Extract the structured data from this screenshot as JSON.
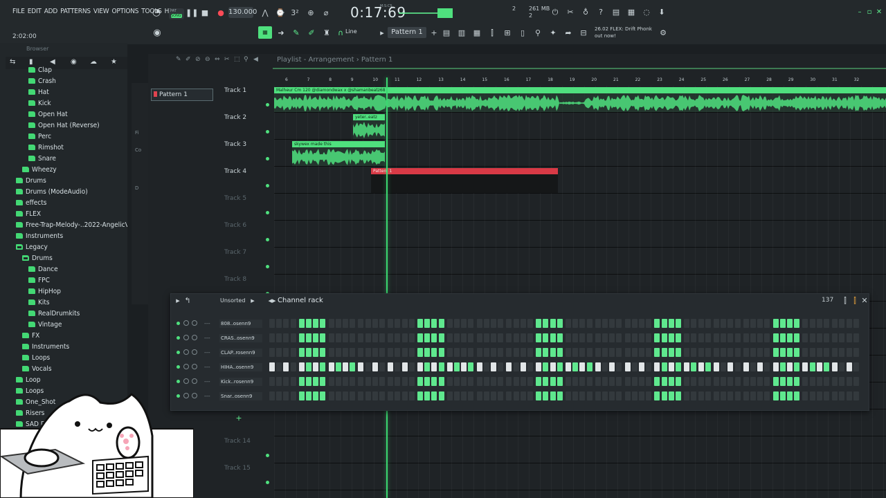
{
  "menu": [
    "FILE",
    "EDIT",
    "ADD",
    "PATTERNS",
    "VIEW",
    "OPTIONS",
    "TOOLS",
    "HELP"
  ],
  "transport": {
    "pat_label": "PAT",
    "song_label": "SONG",
    "bpm": "130.000",
    "time": "0:17:69",
    "time_unit": "M:S:CS",
    "clock": "2:02:00",
    "cpu_label": "2",
    "mem": "261 MB",
    "poly": "2"
  },
  "toolbar": {
    "snap_label": "Line",
    "pattern_select": "Pattern 1",
    "news_line1": "26.02  FLEX: Drift Phonk",
    "news_line2": "out now!"
  },
  "browser": {
    "title": "Browser",
    "items": [
      {
        "label": "Clap",
        "indent": 3,
        "open": false
      },
      {
        "label": "Crash",
        "indent": 3,
        "open": false
      },
      {
        "label": "Hat",
        "indent": 3,
        "open": false
      },
      {
        "label": "Kick",
        "indent": 3,
        "open": false
      },
      {
        "label": "Open Hat",
        "indent": 3,
        "open": false
      },
      {
        "label": "Open Hat (Reverse)",
        "indent": 3,
        "open": false
      },
      {
        "label": "Perc",
        "indent": 3,
        "open": false
      },
      {
        "label": "Rimshot",
        "indent": 3,
        "open": false
      },
      {
        "label": "Snare",
        "indent": 3,
        "open": false
      },
      {
        "label": "Wheezy",
        "indent": 2,
        "open": false
      },
      {
        "label": "Drums",
        "indent": 1,
        "open": false
      },
      {
        "label": "Drums (ModeAudio)",
        "indent": 1,
        "open": false
      },
      {
        "label": "effects",
        "indent": 1,
        "open": false
      },
      {
        "label": "FLEX",
        "indent": 1,
        "open": false
      },
      {
        "label": "Free-Trap-Melody-..2022-AngelicVibes",
        "indent": 1,
        "open": false
      },
      {
        "label": "Instruments",
        "indent": 1,
        "open": false
      },
      {
        "label": "Legacy",
        "indent": 1,
        "open": true
      },
      {
        "label": "Drums",
        "indent": 2,
        "open": true
      },
      {
        "label": "Dance",
        "indent": 3,
        "open": false
      },
      {
        "label": "FPC",
        "indent": 3,
        "open": false
      },
      {
        "label": "HipHop",
        "indent": 3,
        "open": false
      },
      {
        "label": "Kits",
        "indent": 3,
        "open": false
      },
      {
        "label": "RealDrumkits",
        "indent": 3,
        "open": false
      },
      {
        "label": "Vintage",
        "indent": 3,
        "open": false
      },
      {
        "label": "FX",
        "indent": 2,
        "open": false
      },
      {
        "label": "Instruments",
        "indent": 2,
        "open": false
      },
      {
        "label": "Loops",
        "indent": 2,
        "open": false
      },
      {
        "label": "Vocals",
        "indent": 2,
        "open": false
      },
      {
        "label": "Loop",
        "indent": 1,
        "open": false
      },
      {
        "label": "Loops",
        "indent": 1,
        "open": false
      },
      {
        "label": "One_Shot",
        "indent": 1,
        "open": false
      },
      {
        "label": "Risers",
        "indent": 1,
        "open": false
      },
      {
        "label": "SAD DR",
        "indent": 1,
        "open": false
      }
    ]
  },
  "playlist": {
    "title": "Playlist - Arrangement",
    "pattern": "Pattern 1",
    "picker_label": "Pattern 1",
    "ruler": [
      "6",
      "7",
      "8",
      "9",
      "10",
      "11",
      "12",
      "13",
      "14",
      "15",
      "16",
      "17",
      "18",
      "19",
      "20",
      "21",
      "22",
      "23",
      "24",
      "25",
      "26",
      "27",
      "28",
      "29",
      "30",
      "31",
      "32"
    ],
    "tracks": [
      {
        "name": "Track 1",
        "dim": false
      },
      {
        "name": "Track 2",
        "dim": false
      },
      {
        "name": "Track 3",
        "dim": false
      },
      {
        "name": "Track 4",
        "dim": false
      },
      {
        "name": "Track 5",
        "dim": true
      },
      {
        "name": "Track 6",
        "dim": true
      },
      {
        "name": "Track 7",
        "dim": true
      },
      {
        "name": "Track 8",
        "dim": true
      }
    ],
    "bottom_tracks": [
      {
        "name": "Track 14",
        "dim": true
      },
      {
        "name": "Track 15",
        "dim": true
      }
    ],
    "clips": [
      {
        "label": "Malheur Cm 120 @diamondwax x @shamanbeatz68",
        "color": "#4fe07e",
        "type": "audio"
      },
      {
        "label": "yeter..eatz",
        "color": "#4fe07e",
        "type": "audio"
      },
      {
        "label": "skywex made this",
        "color": "#4fe07e",
        "type": "audio"
      },
      {
        "label": "Pattern 1",
        "color": "#d83a46",
        "type": "pattern"
      }
    ]
  },
  "channel_rack": {
    "title": "Channel rack",
    "filter": "Unsorted",
    "swing": "137",
    "channels": [
      {
        "name": "808..osenn9",
        "pattern": "main"
      },
      {
        "name": "CRAS..osenn9",
        "pattern": "main"
      },
      {
        "name": "CLAP..rosenn9",
        "pattern": "main"
      },
      {
        "name": "HIHA..osenn9",
        "pattern": "hat"
      },
      {
        "name": "Kick..rosenn9",
        "pattern": "main"
      },
      {
        "name": "Snar..osenn9",
        "pattern": "main"
      }
    ],
    "step_count": 80,
    "colors": {
      "on": "#5fe88e",
      "off": "#33393d",
      "accent": "#e2e6e8"
    }
  },
  "colors": {
    "accent": "#4fe07e",
    "pattern_red": "#d83a46",
    "bg": "#1b1f22"
  }
}
